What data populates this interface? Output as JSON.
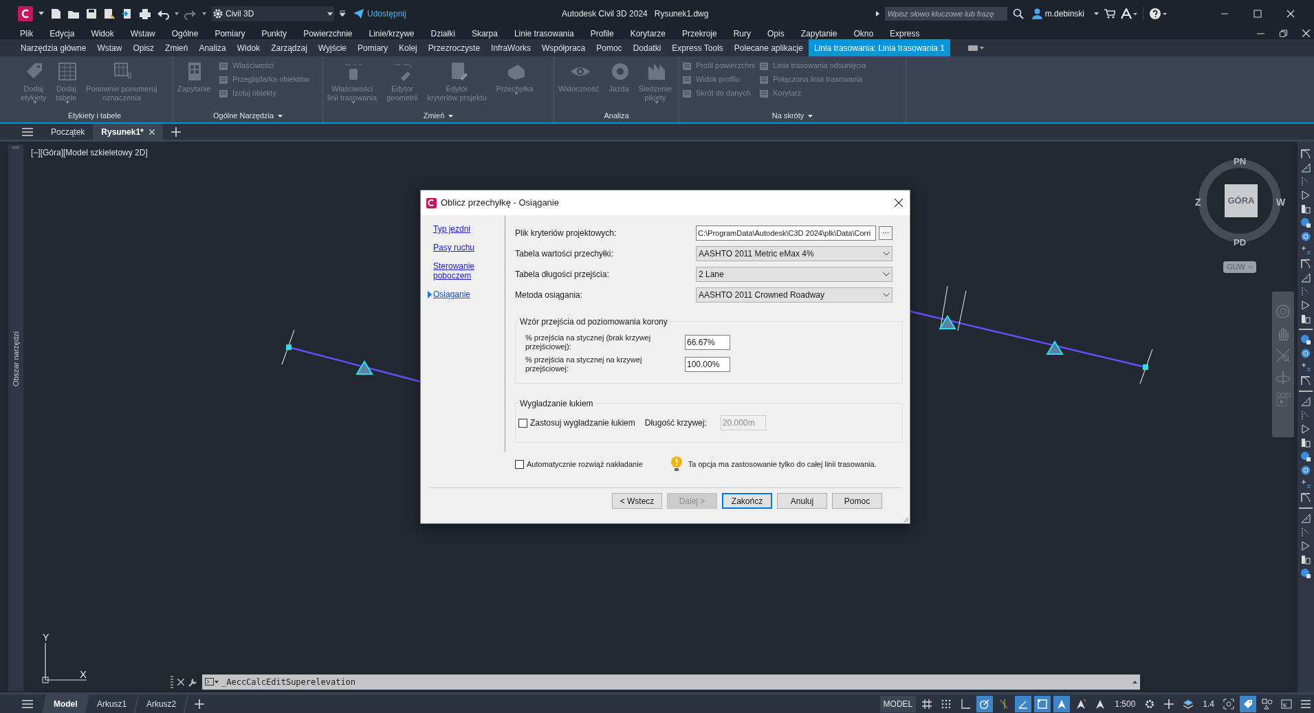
{
  "title_bar": {
    "workspace": "Civil 3D",
    "share": "Udostępnij",
    "app_title": "Autodesk Civil 3D 2024",
    "file_name": "Rysunek1.dwg",
    "search": {
      "placeholder": "Wpisz słowo kluczowe lub frazę"
    },
    "user": "m.debinski"
  },
  "menu_bar": [
    "Plik",
    "Edycja",
    "Widok",
    "Wstaw",
    "Ogólne",
    "Pomiary",
    "Punkty",
    "Powierzchnie",
    "Linie/krzywe",
    "Działki",
    "Skarpa",
    "Linie trasowania",
    "Profile",
    "Korytarze",
    "Przekroje",
    "Rury",
    "Opis",
    "Zapytanie",
    "Okno",
    "Express"
  ],
  "ribbon_tabs": [
    {
      "label": "Narzędzia główne",
      "selected": false
    },
    {
      "label": "Wstaw",
      "selected": false
    },
    {
      "label": "Opisz",
      "selected": false
    },
    {
      "label": "Zmień",
      "selected": false
    },
    {
      "label": "Analiza",
      "selected": false
    },
    {
      "label": "Widok",
      "selected": false
    },
    {
      "label": "Zarządzaj",
      "selected": false
    },
    {
      "label": "Wyjście",
      "selected": false
    },
    {
      "label": "Pomiary",
      "selected": false
    },
    {
      "label": "Kolej",
      "selected": false
    },
    {
      "label": "Przezroczyste",
      "selected": false
    },
    {
      "label": "InfraWorks",
      "selected": false
    },
    {
      "label": "Współpraca",
      "selected": false
    },
    {
      "label": "Pomoc",
      "selected": false
    },
    {
      "label": "Dodatki",
      "selected": false
    },
    {
      "label": "Express Tools",
      "selected": false
    },
    {
      "label": "Polecane aplikacje",
      "selected": false
    },
    {
      "label": "Linia trasowania: Linia trasowania 1",
      "selected": true
    }
  ],
  "ribbon_panels": [
    {
      "title": "Etykiety i tabele",
      "has_menu": false,
      "tools": [
        {
          "kind": "large",
          "label": "Dodaj\netykiety",
          "dropdown": true
        },
        {
          "kind": "large",
          "label": "Dodaj\ntabele",
          "dropdown": true
        },
        {
          "kind": "large",
          "label": "Ponownie ponumeruj\noznaczenia",
          "dropdown": false
        }
      ]
    },
    {
      "title": "Ogólne Narzędzia",
      "has_menu": true,
      "tools": [
        {
          "kind": "large",
          "label": "Zapytanie",
          "dropdown": false
        },
        {
          "kind": "small",
          "label": "Właściwości"
        },
        {
          "kind": "small",
          "label": "Przeglądarka obiektów"
        },
        {
          "kind": "small",
          "label": "Izoluj obiekty"
        }
      ]
    },
    {
      "title": "Zmień",
      "has_menu": true,
      "tools": [
        {
          "kind": "large",
          "label": "Właściwości\nlinii trasowania",
          "dropdown": true
        },
        {
          "kind": "large",
          "label": "Edytor\ngeometrii",
          "dropdown": false
        },
        {
          "kind": "large",
          "label": "Edytor\nkryteriów projektu",
          "dropdown": false
        },
        {
          "kind": "large",
          "label": "Przechyłka",
          "dropdown": true
        }
      ]
    },
    {
      "title": "Analiza",
      "has_menu": false,
      "tools": [
        {
          "kind": "large",
          "label": "Widoczność",
          "dropdown": false
        },
        {
          "kind": "large",
          "label": "Jazda",
          "dropdown": false
        },
        {
          "kind": "large",
          "label": "Śledzenie\npikiety",
          "dropdown": true
        }
      ]
    },
    {
      "title": "Na skróty",
      "has_menu": true,
      "tools": [
        {
          "kind": "small",
          "label": "Profil powierzchni"
        },
        {
          "kind": "small",
          "label": "Widok profilu"
        },
        {
          "kind": "small",
          "label": "Skrót do danych"
        },
        {
          "kind": "small",
          "label": "Linia trasowania odsunięcia"
        },
        {
          "kind": "small",
          "label": "Połączona linia trasowania"
        },
        {
          "kind": "small",
          "label": "Korytarz"
        }
      ]
    }
  ],
  "doc_tabs": [
    {
      "label": "Początek",
      "selected": false,
      "closable": false
    },
    {
      "label": "Rysunek1*",
      "selected": true,
      "closable": true
    }
  ],
  "viewport": {
    "label": "[−][Góra][Model szkieletowy 2D]",
    "palette_title": "Obszar narzędzi",
    "ucs": {
      "y": "Y",
      "x": "X"
    }
  },
  "viewcube": {
    "top": "GÓRA",
    "north": "PN",
    "south": "PD",
    "west": "Z",
    "east": "W",
    "ucs_menu": "GUW"
  },
  "dialog": {
    "title": "Oblicz przechyłkę - Osiąganie",
    "nav": [
      {
        "label": "Typ jezdni",
        "selected": false
      },
      {
        "label": "Pasy ruchu",
        "selected": false
      },
      {
        "label": "Sterowanie poboczem",
        "selected": false
      },
      {
        "label": "Osiąganie",
        "selected": true
      }
    ],
    "fields": [
      {
        "kind": "path",
        "label": "Plik kryteriów projektowych:",
        "value": "C:\\ProgramData\\Autodesk\\C3D 2024\\plk\\Data\\Corri",
        "browse": "···"
      },
      {
        "kind": "select",
        "label": "Tabela wartości przechyłki:",
        "value": "AASHTO 2011 Metric eMax 4%"
      },
      {
        "kind": "select",
        "label": "Tabela długości przejścia:",
        "value": "2 Lane"
      },
      {
        "kind": "select",
        "label": "Metoda osiągania:",
        "value": "AASHTO 2011 Crowned Roadway"
      }
    ],
    "transition_group": {
      "title": "Wzór przejścia od poziomowania korony",
      "rows": [
        {
          "label": "% przejścia na stycznej (brak krzywej przejściowej):",
          "value": "66.67%"
        },
        {
          "label": "% przejścia na stycznej na krzywej przejściowej:",
          "value": "100.00%"
        }
      ]
    },
    "smoothing_group": {
      "title": "Wygładzanie łukiem",
      "checkbox": {
        "label": "Zastosuj wygładzanie łukiem",
        "checked": false
      },
      "length_label": "Długość krzywej:",
      "length": {
        "value": "20.000m",
        "disabled": true
      }
    },
    "auto_resolve": {
      "label": "Automatycznie rozwiąż nakładanie",
      "checked": false
    },
    "note": "Ta opcja ma zastosowanie tylko do całej linii trasowania.",
    "buttons": [
      {
        "label": "< Wstecz",
        "disabled": false,
        "default": false
      },
      {
        "label": "Dalej >",
        "disabled": true,
        "default": false
      },
      {
        "label": "Zakończ",
        "disabled": false,
        "default": true
      },
      {
        "label": "Anuluj",
        "disabled": false,
        "default": false
      },
      {
        "label": "Pomoc",
        "disabled": false,
        "default": false
      }
    ]
  },
  "command_line": {
    "value": "_AeccCalcEditSuperelevation"
  },
  "layout_tabs": [
    {
      "label": "Model",
      "selected": true
    },
    {
      "label": "Arkusz1",
      "selected": false
    },
    {
      "label": "Arkusz2",
      "selected": false
    }
  ],
  "status_bar": [
    {
      "kind": "text",
      "label": "MODEL"
    },
    {
      "kind": "toggle",
      "on": false
    },
    {
      "kind": "toggle",
      "on": false
    },
    {
      "kind": "toggle",
      "on": false
    },
    {
      "kind": "toggle",
      "on": true
    },
    {
      "kind": "toggle",
      "on": false
    },
    {
      "kind": "toggle",
      "on": true
    },
    {
      "kind": "toggle",
      "on": true
    },
    {
      "kind": "toggle",
      "on": true
    },
    {
      "kind": "toggle",
      "on": false
    },
    {
      "kind": "toggle",
      "on": false
    },
    {
      "kind": "text",
      "label": "1:500"
    },
    {
      "kind": "toggle",
      "on": false
    },
    {
      "kind": "toggle",
      "on": false
    },
    {
      "kind": "toggle",
      "on": false
    },
    {
      "kind": "text",
      "label": "1.4"
    },
    {
      "kind": "toggle",
      "on": false
    },
    {
      "kind": "toggle",
      "on": true
    },
    {
      "kind": "toggle",
      "on": false
    },
    {
      "kind": "toggle",
      "on": false
    },
    {
      "kind": "toggle",
      "on": false
    }
  ]
}
